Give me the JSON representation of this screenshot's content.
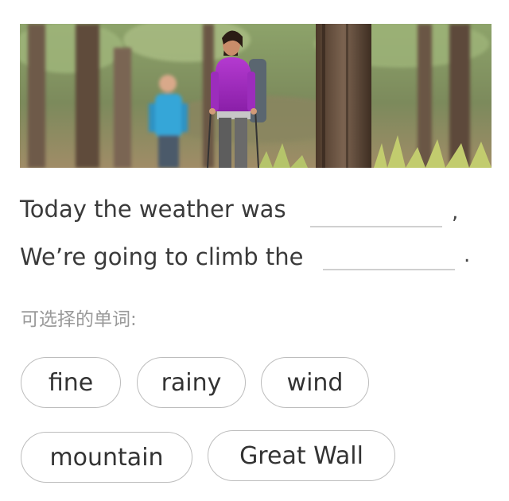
{
  "exercise": {
    "image_alt": "Two hikers walking through a forest",
    "sentences": [
      {
        "text": "Today the weather was",
        "end": ","
      },
      {
        "text": "We’re going to climb the",
        "end": "."
      }
    ],
    "hint_label": "可选择的单词:"
  },
  "choices": [
    "fine",
    "rainy",
    "wind",
    "mountain",
    "Great Wall"
  ]
}
